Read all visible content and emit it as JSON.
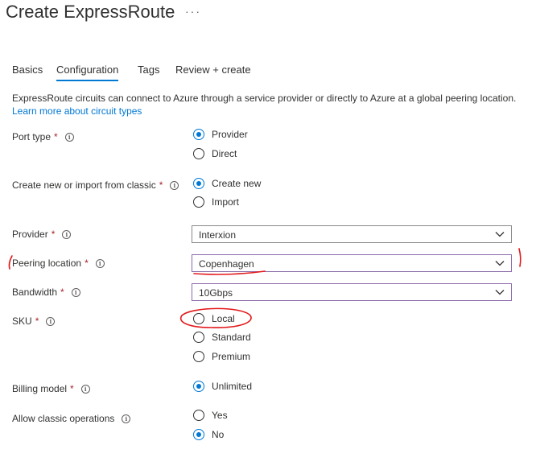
{
  "header": {
    "title": "Create ExpressRoute",
    "more_label": "···"
  },
  "tabs": [
    {
      "label": "Basics"
    },
    {
      "label": "Configuration"
    },
    {
      "label": "Tags"
    },
    {
      "label": "Review + create"
    }
  ],
  "active_tab": "Configuration",
  "intro": {
    "description": "ExpressRoute circuits can connect to Azure through a service provider or directly to Azure at a global peering location.",
    "learn_more": "Learn more about circuit types"
  },
  "required_marker": "*",
  "info_glyph": "i",
  "form": {
    "port_type": {
      "label": "Port type",
      "options": [
        "Provider",
        "Direct"
      ],
      "selected": "Provider"
    },
    "create_mode": {
      "label": "Create new or import from classic",
      "options": [
        "Create new",
        "Import"
      ],
      "selected": "Create new"
    },
    "provider": {
      "label": "Provider",
      "value": "Interxion"
    },
    "peering_location": {
      "label": "Peering location",
      "value": "Copenhagen"
    },
    "bandwidth": {
      "label": "Bandwidth",
      "value": "10Gbps"
    },
    "sku": {
      "label": "SKU",
      "options": [
        "Local",
        "Standard",
        "Premium"
      ],
      "selected": "Local"
    },
    "billing_model": {
      "label": "Billing model",
      "options": [
        "Unlimited"
      ],
      "selected": "Unlimited"
    },
    "classic_operations": {
      "label": "Allow classic operations",
      "options": [
        "Yes",
        "No"
      ],
      "selected": "No"
    }
  },
  "colors": {
    "accent": "#0078d4",
    "required": "#a4262c",
    "annotation": "#e3191b",
    "select_focus": "#8a6aa8"
  }
}
